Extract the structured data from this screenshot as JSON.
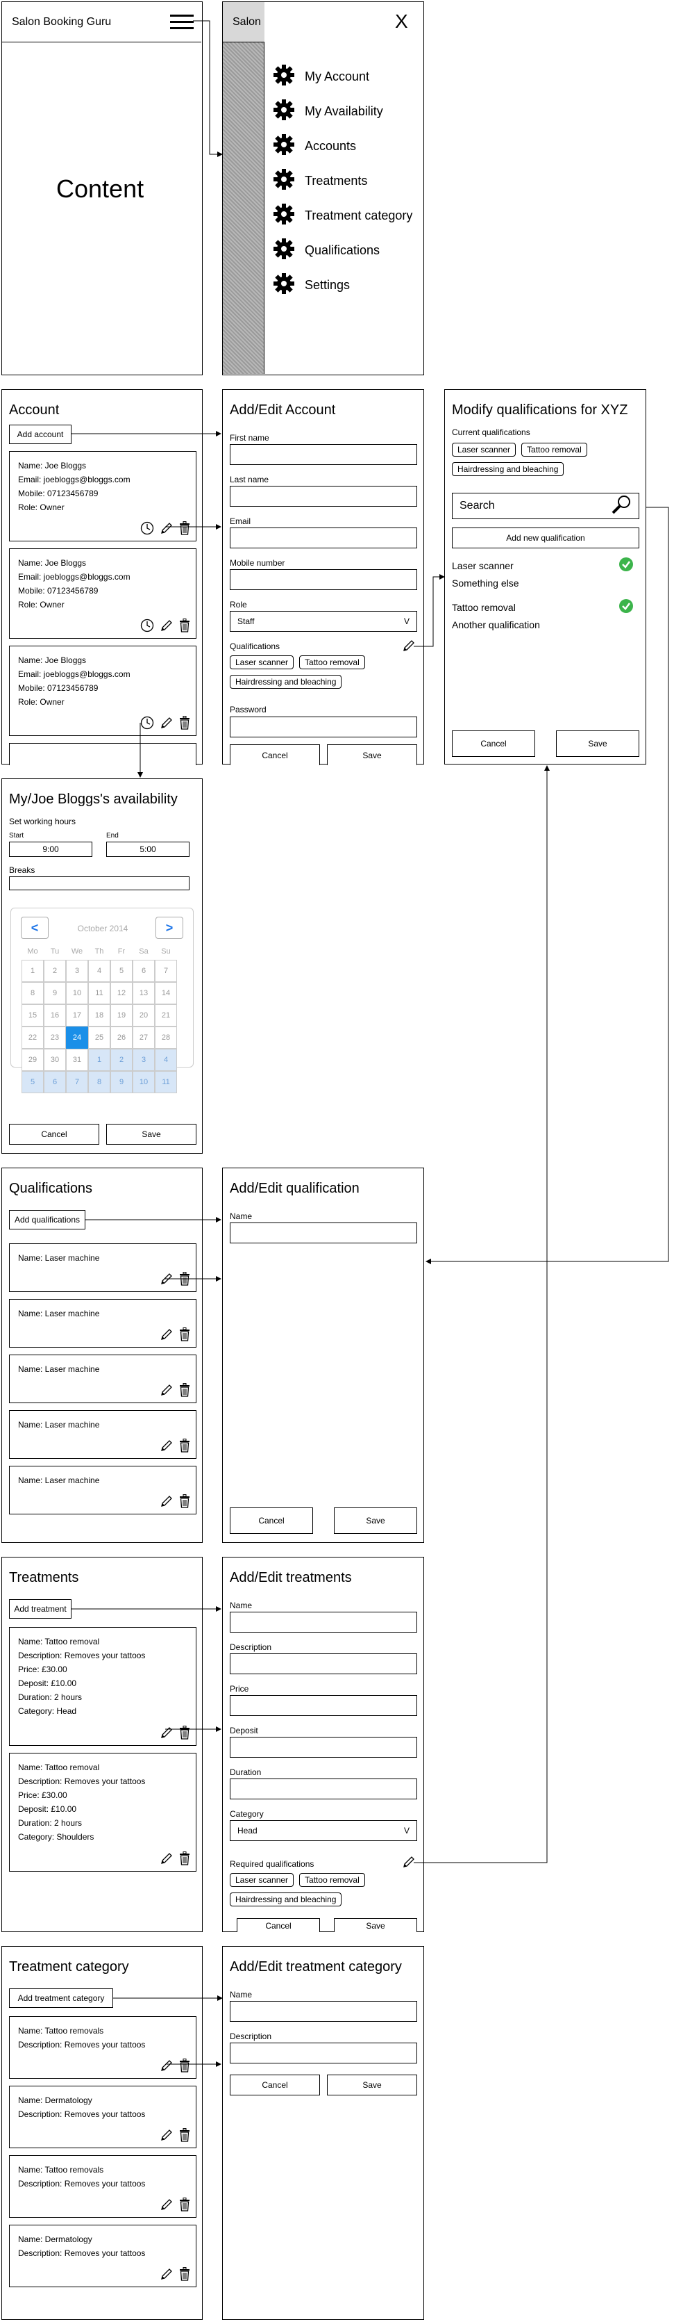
{
  "colors": {
    "check_green": "#3cb44b",
    "calendar_selected": "#1a8fe8",
    "calendar_next_month": "#d7e6f7",
    "sidebar_hatch": "#999999"
  },
  "main": {
    "app_title": "Salon Booking Guru",
    "content_label": "Content",
    "menu_icon": "hamburger-icon"
  },
  "menu": {
    "header_fragment": "Salon",
    "close_label": "X",
    "items": [
      {
        "label": "My Account",
        "icon": "gear-icon"
      },
      {
        "label": "My Availability",
        "icon": "gear-icon"
      },
      {
        "label": "Accounts",
        "icon": "gear-icon"
      },
      {
        "label": "Treatments",
        "icon": "gear-icon"
      },
      {
        "label": "Treatment category",
        "icon": "gear-icon"
      },
      {
        "label": "Qualifications",
        "icon": "gear-icon"
      },
      {
        "label": "Settings",
        "icon": "gear-icon"
      }
    ]
  },
  "accounts": {
    "title": "Account",
    "add_button": "Add account",
    "cards": [
      {
        "name": "Name: Joe Bloggs",
        "email": "Email: joebloggs@bloggs.com",
        "mobile": "Mobile: 07123456789",
        "role": "Role: Owner"
      },
      {
        "name": "Name: Joe Bloggs",
        "email": "Email: joebloggs@bloggs.com",
        "mobile": "Mobile: 07123456789",
        "role": "Role: Owner"
      },
      {
        "name": "Name: Joe Bloggs",
        "email": "Email: joebloggs@bloggs.com",
        "mobile": "Mobile: 07123456789",
        "role": "Role: Owner"
      }
    ]
  },
  "edit_account": {
    "title": "Add/Edit Account",
    "first_name": "First name",
    "last_name": "Last name",
    "email": "Email",
    "mobile": "Mobile number",
    "role_label": "Role",
    "role_value": "Staff",
    "role_caret": "V",
    "qualifications_label": "Qualifications",
    "qualification_chips": [
      "Laser scanner",
      "Tattoo removal",
      "Hairdressing and bleaching"
    ],
    "password": "Password",
    "cancel": "Cancel",
    "save": "Save"
  },
  "modify_quals": {
    "title": "Modify qualifications for XYZ",
    "current_label": "Current qualifications",
    "chips": [
      "Laser scanner",
      "Tattoo removal",
      "Hairdressing and bleaching"
    ],
    "search_placeholder": "Search",
    "add_new": "Add new qualification",
    "results": [
      {
        "label": "Laser scanner",
        "checked": true
      },
      {
        "label": "Something else",
        "checked": false
      },
      {
        "label": "Tattoo removal",
        "checked": true
      },
      {
        "label": "Another qualification",
        "checked": false
      }
    ],
    "cancel": "Cancel",
    "save": "Save"
  },
  "availability": {
    "title": "My/Joe Bloggs's availability",
    "working_hours": "Set working hours",
    "start_label": "Start",
    "start_value": "9:00",
    "end_label": "End",
    "end_value": "5:00",
    "breaks_label": "Breaks",
    "calendar": {
      "month": "October 2014",
      "prev": "<",
      "next": ">",
      "weekdays": [
        "Mo",
        "Tu",
        "We",
        "Th",
        "Fr",
        "Sa",
        "Su"
      ],
      "days": [
        [
          "1",
          "2",
          "3",
          "4",
          "5",
          "6",
          "7"
        ],
        [
          "8",
          "9",
          "10",
          "11",
          "12",
          "13",
          "14"
        ],
        [
          "15",
          "16",
          "17",
          "18",
          "19",
          "20",
          "21"
        ],
        [
          "22",
          "23",
          "24",
          "25",
          "26",
          "27",
          "28"
        ],
        [
          "29",
          "30",
          "31",
          "1",
          "2",
          "3",
          "4"
        ],
        [
          "5",
          "6",
          "7",
          "8",
          "9",
          "10",
          "11"
        ]
      ],
      "selected": "24"
    },
    "cancel": "Cancel",
    "save": "Save"
  },
  "qualifications": {
    "title": "Qualifications",
    "add_button": "Add qualifications",
    "cards": [
      "Name: Laser machine",
      "Name: Laser machine",
      "Name: Laser machine",
      "Name: Laser machine",
      "Name: Laser machine"
    ]
  },
  "edit_qualification": {
    "title": "Add/Edit qualification",
    "name": "Name",
    "cancel": "Cancel",
    "save": "Save"
  },
  "treatments": {
    "title": "Treatments",
    "add_button": "Add treatment",
    "cards": [
      {
        "name": "Name: Tattoo removal",
        "description": "Description: Removes your tattoos",
        "price": "Price: £30.00",
        "deposit": "Deposit: £10.00",
        "duration": "Duration: 2 hours",
        "category": "Category: Head"
      },
      {
        "name": "Name: Tattoo removal",
        "description": "Description: Removes your tattoos",
        "price": "Price: £30.00",
        "deposit": "Deposit: £10.00",
        "duration": "Duration: 2 hours",
        "category": "Category: Shoulders"
      }
    ]
  },
  "edit_treatment": {
    "title": "Add/Edit treatments",
    "name": "Name",
    "description": "Description",
    "price": "Price",
    "deposit": "Deposit",
    "duration": "Duration",
    "category_label": "Category",
    "category_value": "Head",
    "category_caret": "V",
    "required_label": "Required qualifications",
    "chips": [
      "Laser scanner",
      "Tattoo removal",
      "Hairdressing and bleaching"
    ],
    "cancel": "Cancel",
    "save": "Save"
  },
  "categories": {
    "title": "Treatment category",
    "add_button": "Add treatment category",
    "cards": [
      {
        "name": "Name: Tattoo removals",
        "description": "Description: Removes your tattoos"
      },
      {
        "name": "Name: Dermatology",
        "description": "Description: Removes your tattoos"
      },
      {
        "name": "Name: Tattoo removals",
        "description": "Description: Removes your tattoos"
      },
      {
        "name": "Name: Dermatology",
        "description": "Description: Removes your tattoos"
      }
    ]
  },
  "edit_category": {
    "title": "Add/Edit treatment category",
    "name": "Name",
    "description": "Description",
    "cancel": "Cancel",
    "save": "Save"
  }
}
